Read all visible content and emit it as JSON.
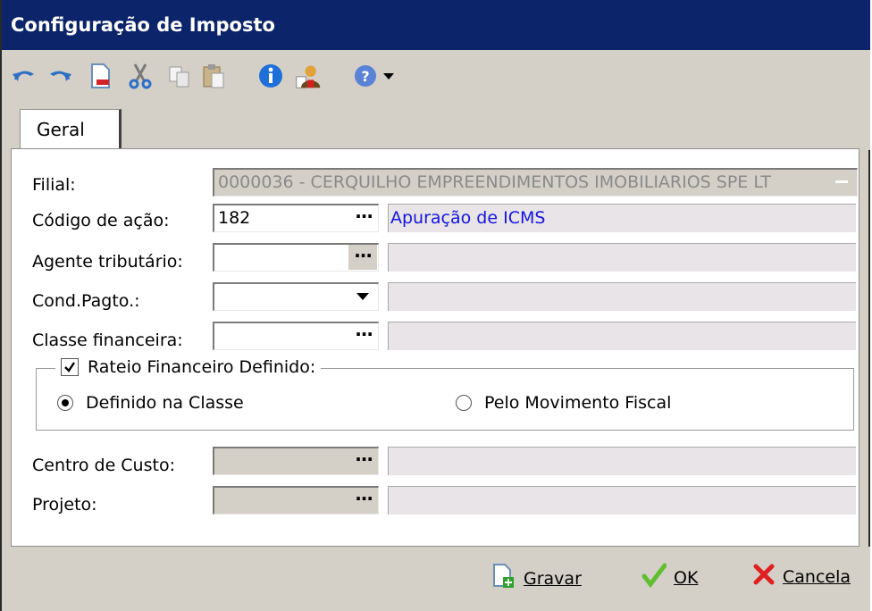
{
  "window": {
    "title": "Configuração de Imposto"
  },
  "toolbar": {
    "icons": [
      "undo-icon",
      "redo-icon",
      "new-document-icon",
      "cut-icon",
      "copy-icon",
      "paste-icon",
      "info-icon",
      "user-icon",
      "help-icon"
    ]
  },
  "tabs": [
    {
      "label": "Geral"
    }
  ],
  "form": {
    "filial": {
      "label": "Filial:",
      "value": "0000036 - CERQUILHO EMPREENDIMENTOS IMOBILIARIOS SPE LT"
    },
    "codigo_acao": {
      "label": "Código de ação:",
      "value": "182",
      "description": "Apuração de ICMS"
    },
    "agente_tributario": {
      "label": "Agente tributário:",
      "value": "",
      "description": ""
    },
    "cond_pagto": {
      "label": "Cond.Pagto.:",
      "value": "",
      "description": ""
    },
    "classe_financeira": {
      "label": "Classe financeira:",
      "value": "",
      "description": ""
    },
    "rateio": {
      "label": "Rateio Financeiro Definido:",
      "checked": true,
      "option_classe": "Definido na Classe",
      "option_movimento": "Pelo Movimento Fiscal",
      "selected": "Definido na Classe"
    },
    "centro_custo": {
      "label": "Centro de Custo:",
      "value": "",
      "description": ""
    },
    "projeto": {
      "label": "Projeto:",
      "value": "",
      "description": ""
    }
  },
  "buttons": {
    "gravar": "Gravar",
    "ok": "OK",
    "cancela": "Cancela"
  },
  "colors": {
    "titlebar": "#0b246a",
    "description_text": "#1414e0"
  }
}
